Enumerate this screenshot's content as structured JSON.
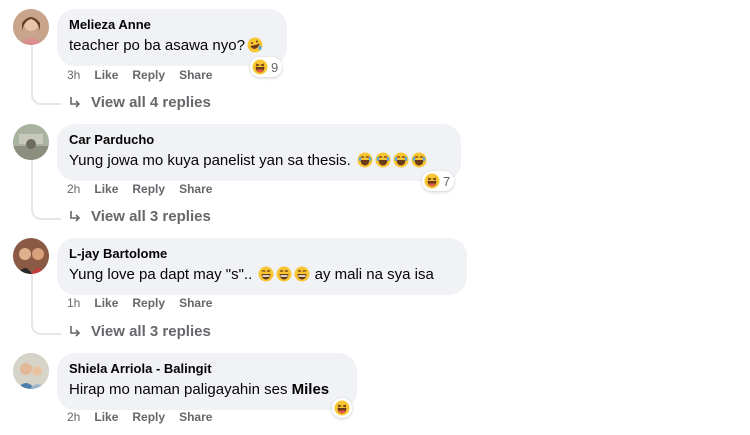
{
  "colors": {
    "bubble": "#f0f2f5",
    "meta": "#65676b",
    "text": "#050505"
  },
  "actions": {
    "like": "Like",
    "reply": "Reply",
    "share": "Share"
  },
  "comments": [
    {
      "author": "Melieza Anne",
      "text": "teacher po ba asawa nyo?",
      "text_emojis": [
        "rofl-emoji"
      ],
      "reaction_count": "9",
      "reaction_icon": "haha-icon",
      "time": "3h",
      "replies_label": "View all 4 replies"
    },
    {
      "author": "Car Parducho",
      "text": "Yung jowa mo kuya panelist yan sa thesis.",
      "text_emojis": [
        "grin-sweat-emoji",
        "grin-sweat-emoji",
        "grin-sweat-emoji",
        "grin-sweat-emoji"
      ],
      "reaction_count": "7",
      "reaction_icon": "haha-icon",
      "time": "2h",
      "replies_label": "View all 3 replies"
    },
    {
      "author": "L-jay Bartolome",
      "text_before": "Yung love pa dapt may \"s\"..",
      "text_after": "ay mali na sya isa",
      "text_emojis": [
        "grin-emoji",
        "grin-emoji",
        "grin-emoji"
      ],
      "time": "1h",
      "replies_label": "View all 3 replies"
    },
    {
      "author": "Shiela Arriola - Balingit",
      "text": "Hirap mo naman paligayahin ses",
      "text_bold": "Miles",
      "reaction_icon": "haha-icon",
      "time": "2h"
    }
  ]
}
